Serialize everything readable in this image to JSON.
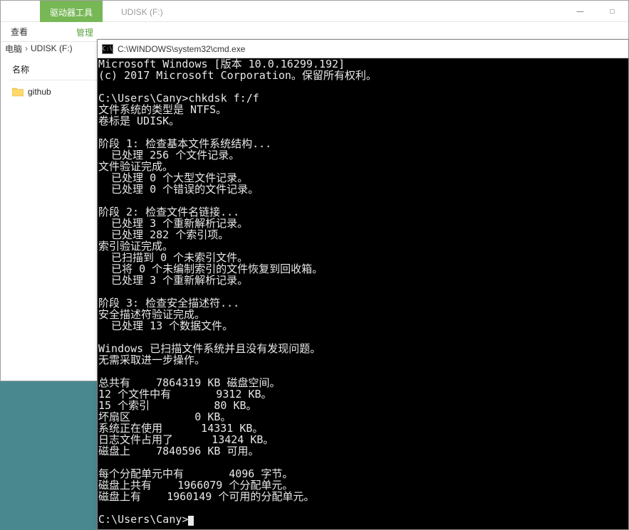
{
  "explorer": {
    "view_tab": "查看",
    "drive_tools_label": "驱动器工具",
    "manage_tab": "管理",
    "title_inactive": "UDISK (F:)",
    "breadcrumb": {
      "root": "电脑",
      "sep": "›",
      "current": "UDISK (F:)"
    },
    "column_name": "名称",
    "files": [
      {
        "name": "github"
      }
    ]
  },
  "window_controls": {
    "minimize": "—",
    "maximize": "□"
  },
  "cmd": {
    "title": "C:\\WINDOWS\\system32\\cmd.exe",
    "icon_text": "C:\\",
    "lines": [
      "Microsoft Windows [版本 10.0.16299.192]",
      "(c) 2017 Microsoft Corporation。保留所有权利。",
      "",
      "C:\\Users\\Cany>chkdsk f:/f",
      "文件系统的类型是 NTFS。",
      "卷标是 UDISK。",
      "",
      "阶段 1: 检查基本文件系统结构...",
      "  已处理 256 个文件记录。",
      "文件验证完成。",
      "  已处理 0 个大型文件记录。",
      "  已处理 0 个错误的文件记录。",
      "",
      "阶段 2: 检查文件名链接...",
      "  已处理 3 个重新解析记录。",
      "  已处理 282 个索引项。",
      "索引验证完成。",
      "  已扫描到 0 个未索引文件。",
      "  已将 0 个未编制索引的文件恢复到回收箱。",
      "  已处理 3 个重新解析记录。",
      "",
      "阶段 3: 检查安全描述符...",
      "安全描述符验证完成。",
      "  已处理 13 个数据文件。",
      "",
      "Windows 已扫描文件系统并且没有发现问题。",
      "无需采取进一步操作。",
      "",
      "总共有    7864319 KB 磁盘空间。",
      "12 个文件中有       9312 KB。",
      "15 个索引          80 KB。",
      "坏扇区          0 KB。",
      "系统正在使用      14331 KB。",
      "日志文件占用了      13424 KB。",
      "磁盘上    7840596 KB 可用。",
      "",
      "每个分配单元中有       4096 字节。",
      "磁盘上共有    1966079 个分配单元。",
      "磁盘上有    1960149 个可用的分配单元。",
      "",
      "C:\\Users\\Cany>"
    ]
  }
}
